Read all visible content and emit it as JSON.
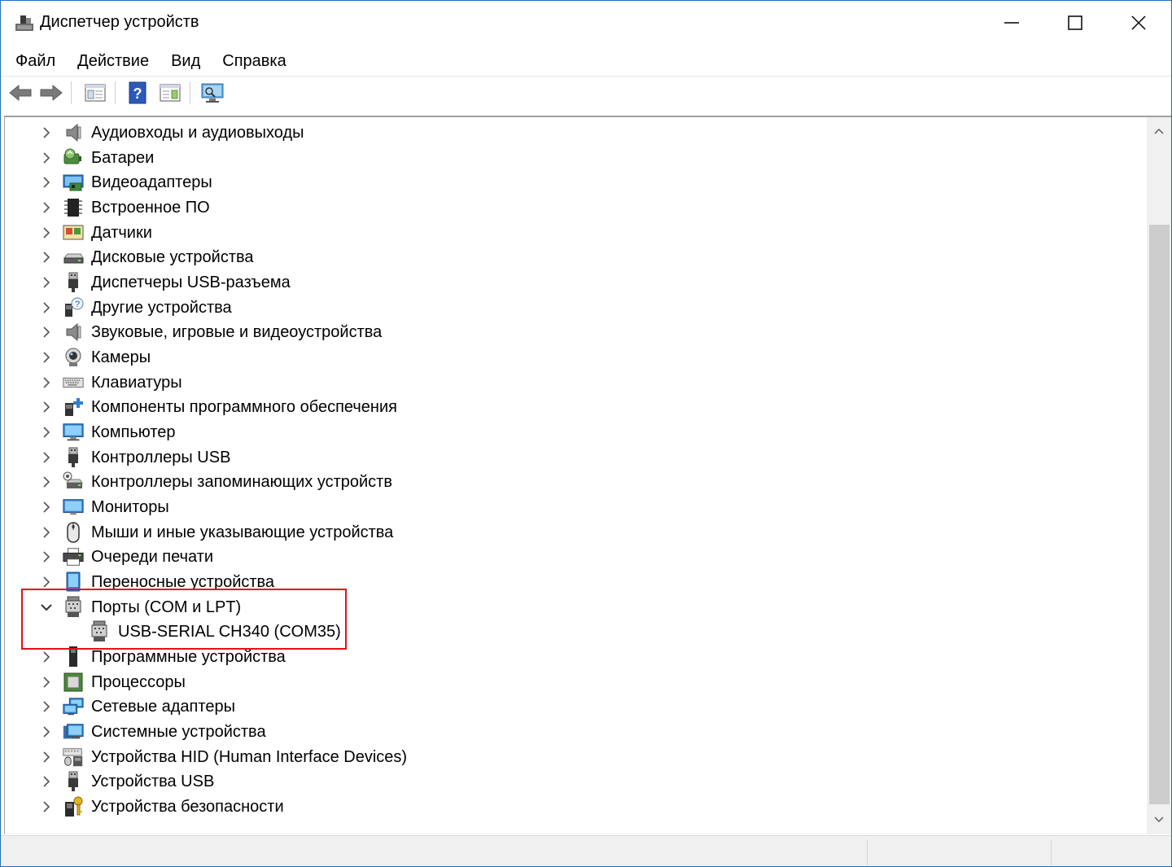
{
  "window": {
    "title": "Диспетчер устройств"
  },
  "menu": [
    "Файл",
    "Действие",
    "Вид",
    "Справка"
  ],
  "toolbar": {
    "buttons": [
      "back-arrow-icon",
      "forward-arrow-icon",
      "properties-pane-icon",
      "help-icon",
      "details-pane-icon",
      "scan-hardware-icon"
    ]
  },
  "tree": {
    "nodes": [
      {
        "label": "Аудиовходы и аудиовыходы",
        "icon": "audio-speaker-icon",
        "expanded": false
      },
      {
        "label": "Батареи",
        "icon": "battery-icon",
        "expanded": false
      },
      {
        "label": "Видеоадаптеры",
        "icon": "display-adapter-icon",
        "expanded": false
      },
      {
        "label": "Встроенное ПО",
        "icon": "firmware-chip-icon",
        "expanded": false
      },
      {
        "label": "Датчики",
        "icon": "sensor-icon",
        "expanded": false
      },
      {
        "label": "Дисковые устройства",
        "icon": "disk-drive-icon",
        "expanded": false
      },
      {
        "label": "Диспетчеры USB-разъема",
        "icon": "usb-plug-icon",
        "expanded": false
      },
      {
        "label": "Другие устройства",
        "icon": "unknown-device-icon",
        "expanded": false
      },
      {
        "label": "Звуковые, игровые и видеоустройства",
        "icon": "speaker-icon",
        "expanded": false
      },
      {
        "label": "Камеры",
        "icon": "webcam-icon",
        "expanded": false
      },
      {
        "label": "Клавиатуры",
        "icon": "keyboard-icon",
        "expanded": false
      },
      {
        "label": "Компоненты программного обеспечения",
        "icon": "software-component-icon",
        "expanded": false
      },
      {
        "label": "Компьютер",
        "icon": "computer-monitor-icon",
        "expanded": false
      },
      {
        "label": "Контроллеры USB",
        "icon": "usb-plug-icon",
        "expanded": false
      },
      {
        "label": "Контроллеры запоминающих устройств",
        "icon": "storage-controller-icon",
        "expanded": false
      },
      {
        "label": "Мониторы",
        "icon": "monitor-icon",
        "expanded": false
      },
      {
        "label": "Мыши и иные указывающие устройства",
        "icon": "mouse-icon",
        "expanded": false
      },
      {
        "label": "Очереди печати",
        "icon": "printer-icon",
        "expanded": false
      },
      {
        "label": "Переносные устройства",
        "icon": "portable-device-icon",
        "expanded": false
      },
      {
        "label": "Порты (COM и LPT)",
        "icon": "port-connector-icon",
        "expanded": true
      },
      {
        "label": "USB-SERIAL CH340 (COM35)",
        "icon": "port-connector-icon",
        "child": true
      },
      {
        "label": "Программные устройства",
        "icon": "software-device-icon",
        "expanded": false
      },
      {
        "label": "Процессоры",
        "icon": "processor-chip-icon",
        "expanded": false
      },
      {
        "label": "Сетевые адаптеры",
        "icon": "network-adapter-icon",
        "expanded": false
      },
      {
        "label": "Системные устройства",
        "icon": "system-folder-icon",
        "expanded": false
      },
      {
        "label": "Устройства HID (Human Interface Devices)",
        "icon": "hid-device-icon",
        "expanded": false
      },
      {
        "label": "Устройства USB",
        "icon": "usb-plug-icon",
        "expanded": false
      },
      {
        "label": "Устройства безопасности",
        "icon": "security-key-icon",
        "expanded": false
      }
    ]
  },
  "colors": {
    "highlight": "#e3101b",
    "frame": "#1f6fb4"
  }
}
